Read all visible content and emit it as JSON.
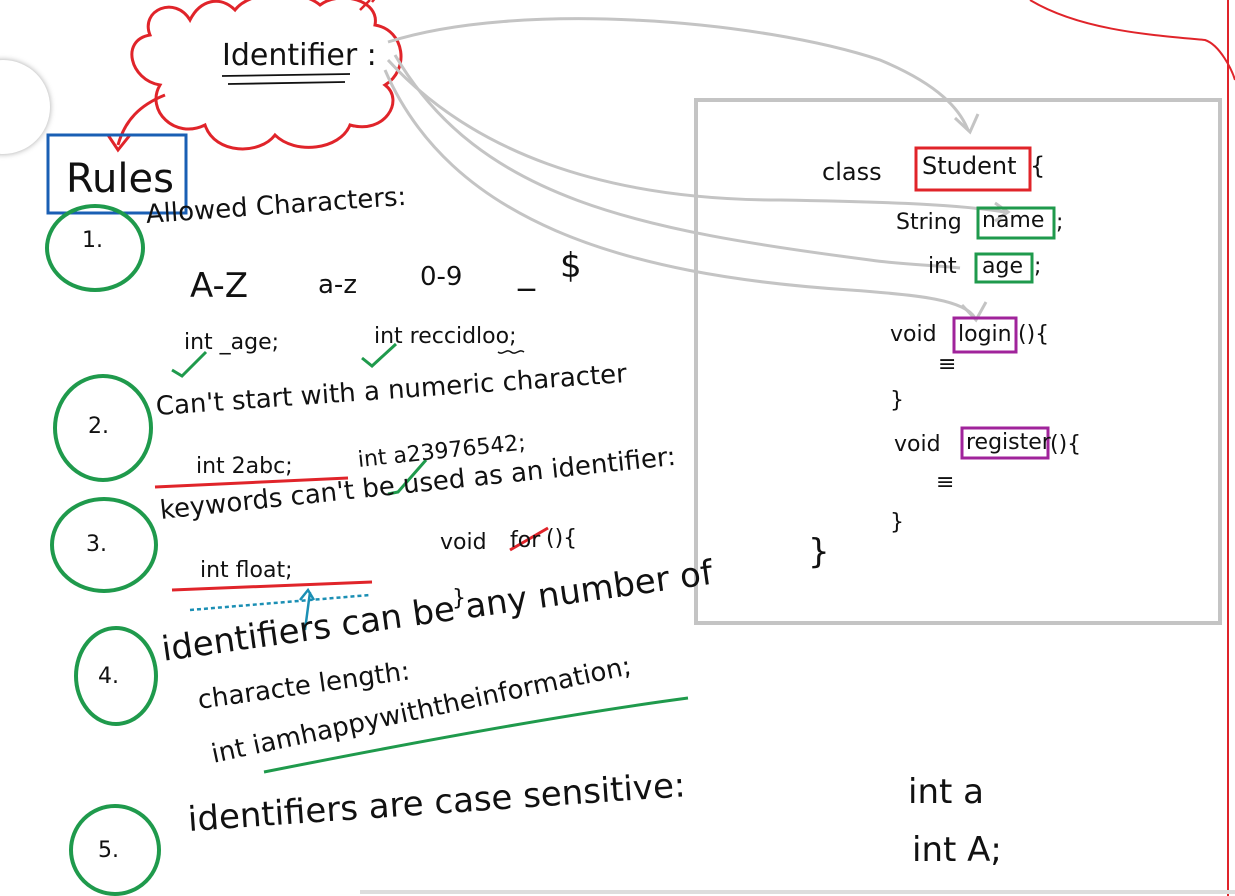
{
  "cloud": {
    "title": "Identifier :"
  },
  "rules_label": "Rules",
  "rules": [
    {
      "number": "1.",
      "text": "Allowed Characters:",
      "charset": [
        "A-Z",
        "a-z",
        "0-9",
        "_",
        "$"
      ],
      "examples": [
        "int _age;",
        "int reccidloo;"
      ]
    },
    {
      "number": "2.",
      "text": "Can't start with a numeric character",
      "bad_example": "int 2abc;",
      "good_example": "int a23976542;"
    },
    {
      "number": "3.",
      "text": "keywords can't be used as an identifier:",
      "bad_example": "int float;",
      "method_prefix": "void",
      "method_name": "for",
      "method_suffix": "(){",
      "close_brace": "}"
    },
    {
      "number": "4.",
      "text_line1": "identifiers can be any number of",
      "text_line2": "characte length:",
      "example": "int iamhappywiththeinformation;"
    },
    {
      "number": "5.",
      "text": "identifiers are case sensitive:",
      "example1": "int a",
      "example2": "int A;"
    }
  ],
  "code_box": {
    "class_kw": "class",
    "class_name": "Student",
    "class_open": "{",
    "field1_type": "String",
    "field1_name": "name",
    "field1_end": ";",
    "field2_type": "int",
    "field2_name": "age",
    "field2_end": ";",
    "method1_type": "void",
    "method1_name": "login",
    "method1_end": "(){",
    "method2_type": "void",
    "method2_name": "register",
    "method2_end": "(){",
    "ellipsis": "≡",
    "close_brace": "}",
    "class_close": "}"
  },
  "colors": {
    "red": "#e0242a",
    "green": "#1f9a4c",
    "blue": "#1a5fb4",
    "purple": "#a0239b",
    "gray": "#c4c4c4",
    "cyan": "#1b8fb4"
  }
}
